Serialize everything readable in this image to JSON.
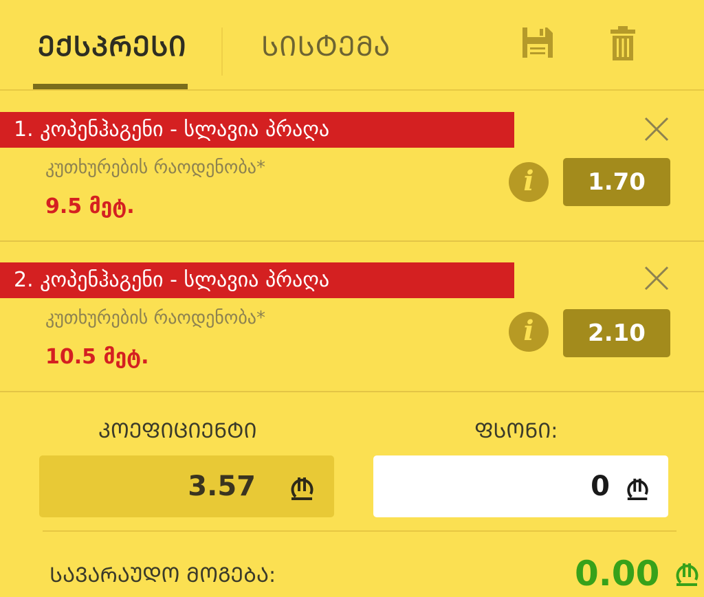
{
  "tabs": [
    {
      "label": "ᲔᲥᲡᲞᲠᲔᲡᲘ",
      "active": true
    },
    {
      "label": "ᲡᲘᲡᲢᲔᲛᲐ",
      "active": false
    }
  ],
  "toolbar": {
    "save_icon": "save-icon",
    "delete_icon": "trash-icon"
  },
  "bets": [
    {
      "title": "1.  კოპენჰაგენი - სლავია პრაღა",
      "market": "კუთხურების რაოდენობა*",
      "pick": "9.5 მეტ.",
      "odds": "1.70"
    },
    {
      "title": "2.  კოპენჰაგენი - სლავია პრაღა",
      "market": "კუთხურების რაოდენობა*",
      "pick": "10.5 მეტ.",
      "odds": "2.10"
    }
  ],
  "summary": {
    "coef_label": "ᲙᲝᲔᲤᲘᲪᲘᲔᲜᲢᲘ",
    "coef_value": "3.57",
    "stake_label": "ᲤᲡᲝᲜᲘ:",
    "stake_value": "0",
    "win_label": "ᲡᲐᲕᲐᲠᲐᲣᲓᲝ ᲛᲝᲒᲔᲑᲐ:",
    "win_value": "0.00",
    "currency_icon": "lari-icon"
  },
  "colors": {
    "background": "#fbe052",
    "accent_red": "#d42021",
    "odds_box": "#a38b1c",
    "win_green": "#37a11a",
    "tab_underline": "#7a6d1c"
  }
}
